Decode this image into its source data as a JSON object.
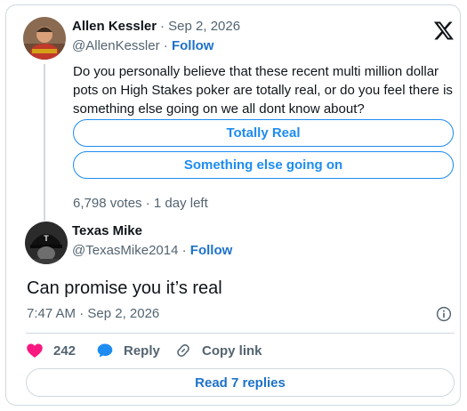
{
  "quoted_tweet": {
    "author_name": "Allen Kessler",
    "date": "· Sep 2, 2026",
    "handle": "@AllenKessler",
    "separator": "·",
    "follow_label": "Follow",
    "text": "Do you personally believe that these recent multi million dollar pots on High Stakes poker are totally real, or do you feel there is something else going on we all dont know about?",
    "poll": {
      "options": [
        "Totally Real",
        "Something else going on"
      ],
      "summary": "6,798 votes · 1 day left"
    }
  },
  "reply_tweet": {
    "author_name": "Texas Mike",
    "handle": "@TexasMike2014",
    "separator": "·",
    "follow_label": "Follow",
    "text": "Can promise you it’s real",
    "timestamp": "7:47 AM · Sep 2, 2026"
  },
  "actions": {
    "like_count": "242",
    "reply_label": "Reply",
    "copy_link_label": "Copy link",
    "read_replies_label": "Read 7 replies"
  },
  "icons": {
    "brand": "x-logo-icon",
    "like": "heart-icon",
    "reply": "speech-bubble-icon",
    "copy": "link-icon",
    "info": "info-icon"
  },
  "colors": {
    "accent": "#1d8cf0",
    "follow": "#1d72c9",
    "heart": "#f91880",
    "secondary_text": "#536471",
    "border": "#cfd9de"
  }
}
